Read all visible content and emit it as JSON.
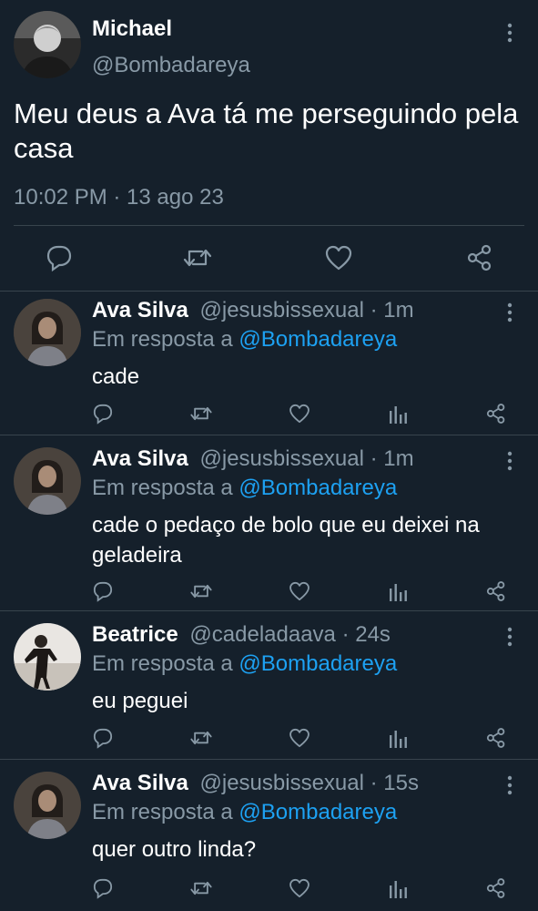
{
  "main_tweet": {
    "name": "Michael",
    "handle": "@Bombadareya",
    "text": "Meu deus a Ava tá me perseguindo pela casa",
    "timestamp": "10:02 PM · 13 ago 23",
    "avatar_icon": "profile-photo",
    "actions": [
      "reply-icon",
      "retweet-icon",
      "like-icon",
      "share-icon"
    ]
  },
  "replies": [
    {
      "name": "Ava Silva",
      "handle": "@jesusbissexual",
      "time": "· 1m",
      "reply_prefix": "Em resposta a",
      "reply_to": "@Bombadareya",
      "text": "cade"
    },
    {
      "name": "Ava Silva",
      "handle": "@jesusbissexual",
      "time": "· 1m",
      "reply_prefix": "Em resposta a",
      "reply_to": "@Bombadareya",
      "text": "cade o pedaço de bolo que eu deixei na geladeira"
    },
    {
      "name": "Beatrice",
      "handle": "@cadeladaava",
      "time": "· 24s",
      "reply_prefix": "Em resposta a",
      "reply_to": "@Bombadareya",
      "text": "eu peguei"
    },
    {
      "name": "Ava Silva",
      "handle": "@jesusbissexual",
      "time": "· 15s",
      "reply_prefix": "Em resposta a",
      "reply_to": "@Bombadareya",
      "text": "quer outro linda?"
    }
  ],
  "colors": {
    "background": "#15202b",
    "muted": "#8899a6",
    "link": "#1da1f2",
    "divider": "#38444d"
  }
}
